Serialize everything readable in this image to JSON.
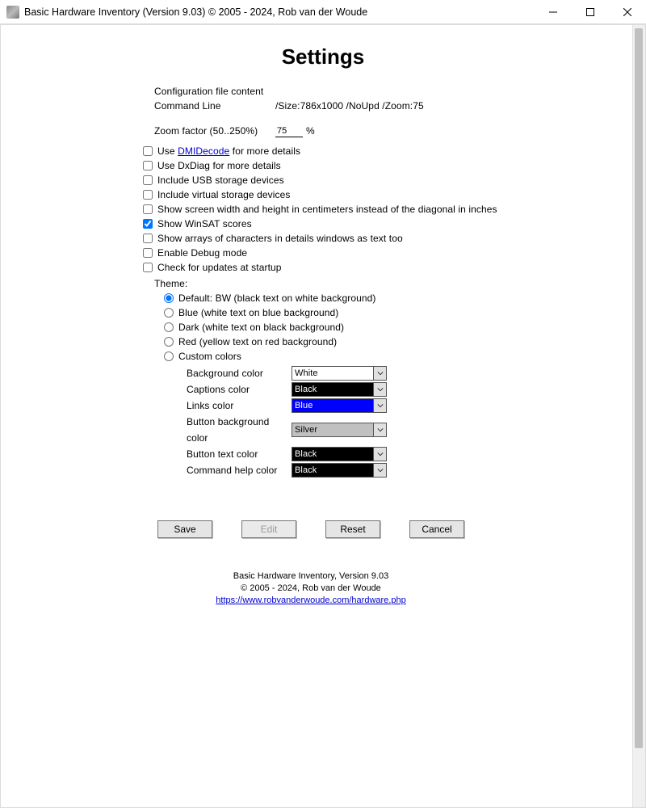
{
  "window": {
    "title": "Basic Hardware Inventory (Version 9.03) © 2005 - 2024, Rob van der Woude"
  },
  "page": {
    "heading": "Settings",
    "config_label": "Configuration file content",
    "cmdline_label": "Command Line",
    "cmdline_value": "/Size:786x1000 /NoUpd /Zoom:75",
    "zoom_label": "Zoom factor (50..250%)",
    "zoom_value": "75",
    "zoom_percent": "%"
  },
  "checks": {
    "dmid_prefix": "Use ",
    "dmid_link": "DMIDecode",
    "dmid_suffix": " for more details",
    "dxdiag": "Use DxDiag for more details",
    "usb": "Include USB storage devices",
    "virtual": "Include virtual storage devices",
    "screen_cm": "Show screen width and height in centimeters instead of the diagonal in inches",
    "winsat": "Show WinSAT scores",
    "char_arrays": "Show arrays of characters in details windows as text too",
    "debug": "Enable Debug mode",
    "updates": "Check for updates at startup"
  },
  "theme": {
    "title": "Theme:",
    "default": "Default: BW (black text on white background)",
    "blue": "Blue (white text on blue background)",
    "dark": "Dark (white text on black background)",
    "red": "Red (yellow text on red background)",
    "custom": "Custom colors"
  },
  "colors": {
    "bg_label": "Background color",
    "bg_value": "White",
    "cap_label": "Captions color",
    "cap_value": "Black",
    "link_label": "Links color",
    "link_value": "Blue",
    "btnbg_label": "Button background color",
    "btnbg_value": "Silver",
    "btntxt_label": "Button text color",
    "btntxt_value": "Black",
    "cmdhelp_label": "Command help color",
    "cmdhelp_value": "Black"
  },
  "buttons": {
    "save": "Save",
    "edit": "Edit",
    "reset": "Reset",
    "cancel": "Cancel"
  },
  "footer": {
    "line1": "Basic Hardware Inventory,  Version 9.03",
    "line2": "© 2005 - 2024, Rob van der Woude",
    "link": "https://www.robvanderwoude.com/hardware.php"
  }
}
